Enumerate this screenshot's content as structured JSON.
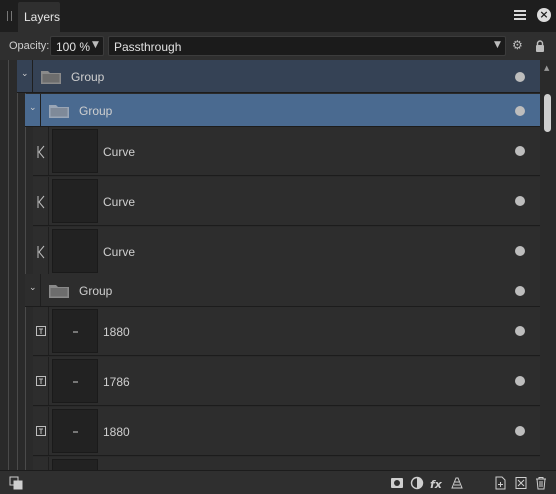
{
  "panel": {
    "tab_label": "Layers"
  },
  "options": {
    "opacity_label": "Opacity:",
    "opacity_value": "100 %",
    "blend_mode": "Passthrough"
  },
  "layers": [
    {
      "name": "Group",
      "kind": "group",
      "depth": 0,
      "state": "expanded"
    },
    {
      "name": "Group",
      "kind": "group",
      "depth": 1,
      "state": "selected"
    },
    {
      "name": "Curve",
      "kind": "curve",
      "depth": 2
    },
    {
      "name": "Curve",
      "kind": "curve",
      "depth": 2
    },
    {
      "name": "Curve",
      "kind": "curve",
      "depth": 2
    },
    {
      "name": "Group",
      "kind": "group",
      "depth": 1,
      "state": "expanded"
    },
    {
      "name": "1880",
      "kind": "text",
      "depth": 2
    },
    {
      "name": "1786",
      "kind": "text",
      "depth": 2
    },
    {
      "name": "1880",
      "kind": "text",
      "depth": 2
    }
  ],
  "colors": {
    "selected_row": "#4a6a90",
    "parent_group_row": "#354255",
    "panel_bg": "#2b2b2b"
  },
  "icons": {
    "title": [
      "grip-icon",
      "menu-icon",
      "close-icon"
    ],
    "options": [
      "chevron-down-icon",
      "gear-icon",
      "lock-icon"
    ],
    "bottom_left": "arrange-icon",
    "bottom_right": [
      "mask-icon",
      "adjustment-icon",
      "fx-icon",
      "live-filter-icon",
      "add-layer-icon",
      "add-group-icon",
      "delete-icon"
    ]
  }
}
